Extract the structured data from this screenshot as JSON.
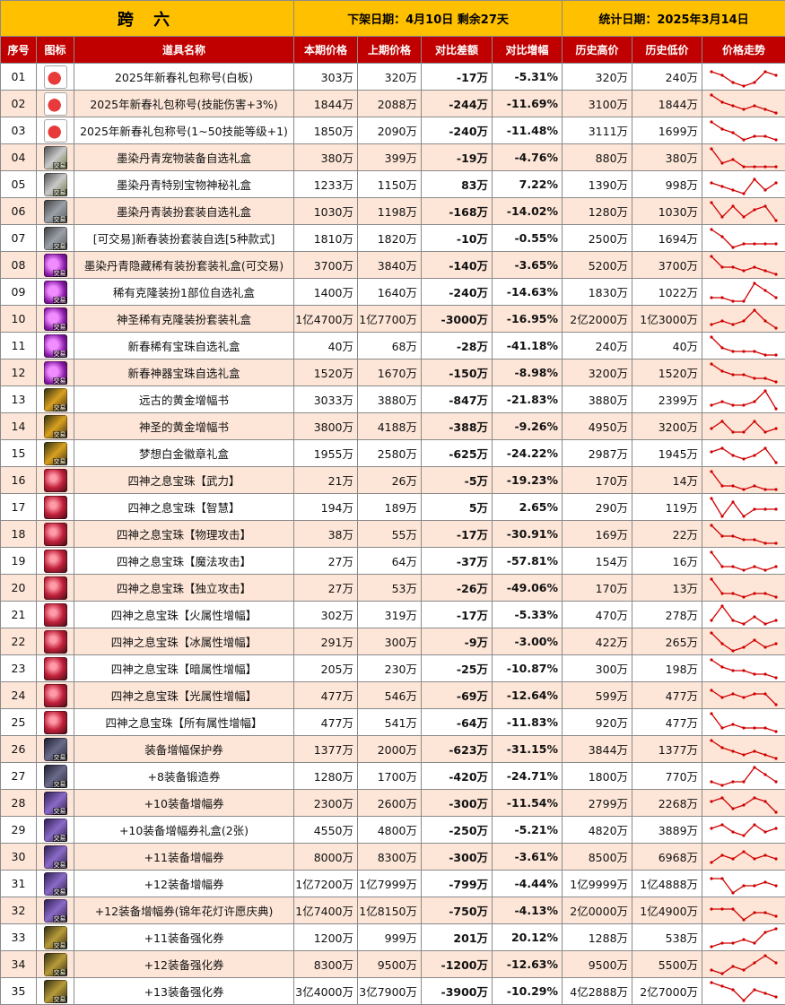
{
  "header": {
    "region": "跨 六",
    "removal": "下架日期：4月10日  剩余27天",
    "stat_date": "统计日期：2025年3月14日"
  },
  "columns": [
    "序号",
    "图标",
    "道具名称",
    "本期价格",
    "上期价格",
    "对比差额",
    "对比增幅",
    "历史高价",
    "历史低价",
    "价格走势"
  ],
  "colors": {
    "header_bg": "#ffc000",
    "column_bg": "#c00000",
    "alt_row": "#fde6d8",
    "up": "#e00000",
    "down": "#1aa34a"
  },
  "rows": [
    {
      "no": "01",
      "icon": "gift-icon",
      "tag": "",
      "name": "2025年新春礼包称号(白板)",
      "cur": "303万",
      "prev": "320万",
      "diff": "-17万",
      "pct": "-5.31%",
      "high": "320万",
      "low": "240万",
      "trend": [
        5,
        4,
        2,
        1,
        2,
        5,
        4
      ]
    },
    {
      "no": "02",
      "icon": "gift-icon",
      "tag": "",
      "name": "2025年新春礼包称号(技能伤害+3%)",
      "cur": "1844万",
      "prev": "2088万",
      "diff": "-244万",
      "pct": "-11.69%",
      "high": "3100万",
      "low": "1844万",
      "trend": [
        6,
        4,
        3,
        2,
        3,
        2,
        1
      ]
    },
    {
      "no": "03",
      "icon": "gift-icon",
      "tag": "",
      "name": "2025年新春礼包称号(1~50技能等级+1)",
      "cur": "1850万",
      "prev": "2090万",
      "diff": "-240万",
      "pct": "-11.48%",
      "high": "3111万",
      "low": "1699万",
      "trend": [
        6,
        4,
        3,
        1,
        2,
        2,
        1
      ]
    },
    {
      "no": "04",
      "icon": "dye-icon",
      "tag": "交易",
      "name": "墨染丹青宠物装备自选礼盒",
      "cur": "380万",
      "prev": "399万",
      "diff": "-19万",
      "pct": "-4.76%",
      "high": "880万",
      "low": "380万",
      "trend": [
        6,
        2,
        3,
        1,
        1,
        1,
        1
      ]
    },
    {
      "no": "05",
      "icon": "dye-icon",
      "tag": "交易",
      "name": "墨染丹青特别宝物神秘礼盒",
      "cur": "1233万",
      "prev": "1150万",
      "diff": "83万",
      "pct": "7.22%",
      "high": "1390万",
      "low": "998万",
      "trend": [
        4,
        3,
        2,
        1,
        5,
        2,
        4
      ]
    },
    {
      "no": "06",
      "icon": "dye2-icon",
      "tag": "交易",
      "name": "墨染丹青装扮套装自选礼盒",
      "cur": "1030万",
      "prev": "1198万",
      "diff": "-168万",
      "pct": "-14.02%",
      "high": "1280万",
      "low": "1030万",
      "trend": [
        6,
        2,
        5,
        2,
        4,
        5,
        1
      ]
    },
    {
      "no": "07",
      "icon": "dye2-icon",
      "tag": "交易",
      "name": "[可交易]新春装扮套装自选[5种款式]",
      "cur": "1810万",
      "prev": "1820万",
      "diff": "-10万",
      "pct": "-0.55%",
      "high": "2500万",
      "low": "1694万",
      "trend": [
        6,
        4,
        1,
        2,
        2,
        2,
        2
      ]
    },
    {
      "no": "08",
      "icon": "purple-icon",
      "tag": "交易",
      "name": "墨染丹青隐藏稀有装扮套装礼盒(可交易)",
      "cur": "3700万",
      "prev": "3840万",
      "diff": "-140万",
      "pct": "-3.65%",
      "high": "5200万",
      "low": "3700万",
      "trend": [
        6,
        3,
        3,
        2,
        3,
        2,
        1
      ]
    },
    {
      "no": "09",
      "icon": "purple-icon",
      "tag": "交易",
      "name": "稀有克隆装扮1部位自选礼盒",
      "cur": "1400万",
      "prev": "1640万",
      "diff": "-240万",
      "pct": "-14.63%",
      "high": "1830万",
      "low": "1022万",
      "trend": [
        2,
        2,
        1,
        1,
        6,
        4,
        2
      ]
    },
    {
      "no": "10",
      "icon": "purple-icon",
      "tag": "交易",
      "name": "神圣稀有克隆装扮套装礼盒",
      "cur": "1亿4700万",
      "prev": "1亿7700万",
      "diff": "-3000万",
      "pct": "-16.95%",
      "high": "2亿2000万",
      "low": "1亿3000万",
      "trend": [
        2,
        3,
        2,
        3,
        6,
        3,
        1
      ]
    },
    {
      "no": "11",
      "icon": "purple-icon",
      "tag": "交易",
      "name": "新春稀有宝珠自选礼盒",
      "cur": "40万",
      "prev": "68万",
      "diff": "-28万",
      "pct": "-41.18%",
      "high": "240万",
      "low": "40万",
      "trend": [
        6,
        3,
        2,
        2,
        2,
        1,
        1
      ]
    },
    {
      "no": "12",
      "icon": "purple-icon",
      "tag": "交易",
      "name": "新春神器宝珠自选礼盒",
      "cur": "1520万",
      "prev": "1670万",
      "diff": "-150万",
      "pct": "-8.98%",
      "high": "3200万",
      "low": "1520万",
      "trend": [
        6,
        4,
        3,
        3,
        2,
        2,
        1
      ]
    },
    {
      "no": "13",
      "icon": "gold-icon",
      "tag": "交易",
      "name": "远古的黄金增幅书",
      "cur": "3033万",
      "prev": "3880万",
      "diff": "-847万",
      "pct": "-21.83%",
      "high": "3880万",
      "low": "2399万",
      "trend": [
        2,
        3,
        2,
        2,
        3,
        6,
        1
      ]
    },
    {
      "no": "14",
      "icon": "gold-icon",
      "tag": "交易",
      "name": "神圣的黄金增幅书",
      "cur": "3800万",
      "prev": "4188万",
      "diff": "-388万",
      "pct": "-9.26%",
      "high": "4950万",
      "low": "3200万",
      "trend": [
        3,
        5,
        2,
        2,
        5,
        2,
        3
      ]
    },
    {
      "no": "15",
      "icon": "gold-icon",
      "tag": "交易",
      "name": "梦想白金徽章礼盒",
      "cur": "1955万",
      "prev": "2580万",
      "diff": "-625万",
      "pct": "-24.22%",
      "high": "2987万",
      "low": "1945万",
      "trend": [
        4,
        5,
        3,
        2,
        3,
        5,
        1
      ]
    },
    {
      "no": "16",
      "icon": "gem-icon",
      "tag": "",
      "name": "四神之息宝珠【武力】",
      "cur": "21万",
      "prev": "26万",
      "diff": "-5万",
      "pct": "-19.23%",
      "high": "170万",
      "low": "14万",
      "trend": [
        6,
        2,
        2,
        1,
        2,
        1,
        1
      ]
    },
    {
      "no": "17",
      "icon": "gem-icon",
      "tag": "",
      "name": "四神之息宝珠【智慧】",
      "cur": "194万",
      "prev": "189万",
      "diff": "5万",
      "pct": "2.65%",
      "high": "290万",
      "low": "119万",
      "trend": [
        6,
        1,
        5,
        1,
        3,
        3,
        3
      ]
    },
    {
      "no": "18",
      "icon": "gem-icon",
      "tag": "",
      "name": "四神之息宝珠【物理攻击】",
      "cur": "38万",
      "prev": "55万",
      "diff": "-17万",
      "pct": "-30.91%",
      "high": "169万",
      "low": "22万",
      "trend": [
        6,
        3,
        3,
        2,
        2,
        1,
        1
      ]
    },
    {
      "no": "19",
      "icon": "gem-icon",
      "tag": "",
      "name": "四神之息宝珠【魔法攻击】",
      "cur": "27万",
      "prev": "64万",
      "diff": "-37万",
      "pct": "-57.81%",
      "high": "154万",
      "low": "16万",
      "trend": [
        6,
        2,
        2,
        1,
        2,
        1,
        2
      ]
    },
    {
      "no": "20",
      "icon": "gem-icon",
      "tag": "",
      "name": "四神之息宝珠【独立攻击】",
      "cur": "27万",
      "prev": "53万",
      "diff": "-26万",
      "pct": "-49.06%",
      "high": "170万",
      "low": "13万",
      "trend": [
        6,
        2,
        2,
        1,
        2,
        2,
        1
      ]
    },
    {
      "no": "21",
      "icon": "gem-icon",
      "tag": "",
      "name": "四神之息宝珠【火属性增幅】",
      "cur": "302万",
      "prev": "319万",
      "diff": "-17万",
      "pct": "-5.33%",
      "high": "470万",
      "low": "278万",
      "trend": [
        2,
        6,
        2,
        1,
        3,
        1,
        2
      ]
    },
    {
      "no": "22",
      "icon": "gem-icon",
      "tag": "",
      "name": "四神之息宝珠【冰属性增幅】",
      "cur": "291万",
      "prev": "300万",
      "diff": "-9万",
      "pct": "-3.00%",
      "high": "422万",
      "low": "265万",
      "trend": [
        6,
        3,
        1,
        2,
        4,
        2,
        3
      ]
    },
    {
      "no": "23",
      "icon": "gem-icon",
      "tag": "",
      "name": "四神之息宝珠【暗属性增幅】",
      "cur": "205万",
      "prev": "230万",
      "diff": "-25万",
      "pct": "-10.87%",
      "high": "300万",
      "low": "198万",
      "trend": [
        6,
        4,
        3,
        3,
        2,
        2,
        1
      ]
    },
    {
      "no": "24",
      "icon": "gem-icon",
      "tag": "",
      "name": "四神之息宝珠【光属性增幅】",
      "cur": "477万",
      "prev": "546万",
      "diff": "-69万",
      "pct": "-12.64%",
      "high": "599万",
      "low": "477万",
      "trend": [
        5,
        3,
        4,
        3,
        4,
        4,
        1
      ]
    },
    {
      "no": "25",
      "icon": "gem-icon",
      "tag": "",
      "name": "四神之息宝珠【所有属性增幅】",
      "cur": "477万",
      "prev": "541万",
      "diff": "-64万",
      "pct": "-11.83%",
      "high": "920万",
      "low": "477万",
      "trend": [
        6,
        2,
        3,
        2,
        2,
        2,
        1
      ]
    },
    {
      "no": "26",
      "icon": "ticket-icon",
      "tag": "交易",
      "name": "装备增幅保护券",
      "cur": "1377万",
      "prev": "2000万",
      "diff": "-623万",
      "pct": "-31.15%",
      "high": "3844万",
      "low": "1377万",
      "trend": [
        6,
        4,
        3,
        2,
        3,
        2,
        1
      ]
    },
    {
      "no": "27",
      "icon": "ticket-icon",
      "tag": "交易",
      "name": "+8装备锻造券",
      "cur": "1280万",
      "prev": "1700万",
      "diff": "-420万",
      "pct": "-24.71%",
      "high": "1800万",
      "low": "770万",
      "trend": [
        2,
        1,
        2,
        2,
        6,
        4,
        2
      ]
    },
    {
      "no": "28",
      "icon": "ticket2-icon",
      "tag": "交易",
      "name": "+10装备增幅券",
      "cur": "2300万",
      "prev": "2600万",
      "diff": "-300万",
      "pct": "-11.54%",
      "high": "2799万",
      "low": "2268万",
      "trend": [
        4,
        5,
        2,
        3,
        5,
        4,
        1
      ]
    },
    {
      "no": "29",
      "icon": "ticket2-icon",
      "tag": "交易",
      "name": "+10装备增幅券礼盒(2张)",
      "cur": "4550万",
      "prev": "4800万",
      "diff": "-250万",
      "pct": "-5.21%",
      "high": "4820万",
      "low": "3889万",
      "trend": [
        4,
        5,
        3,
        2,
        5,
        3,
        4
      ]
    },
    {
      "no": "30",
      "icon": "ticket2-icon",
      "tag": "交易",
      "name": "+11装备增幅券",
      "cur": "8000万",
      "prev": "8300万",
      "diff": "-300万",
      "pct": "-3.61%",
      "high": "8500万",
      "low": "6968万",
      "trend": [
        2,
        4,
        3,
        5,
        3,
        4,
        3
      ]
    },
    {
      "no": "31",
      "icon": "ticket2-icon",
      "tag": "交易",
      "name": "+12装备增幅券",
      "cur": "1亿7200万",
      "prev": "1亿7999万",
      "diff": "-799万",
      "pct": "-4.44%",
      "high": "1亿9999万",
      "low": "1亿4888万",
      "trend": [
        5,
        5,
        1,
        3,
        3,
        4,
        3
      ]
    },
    {
      "no": "32",
      "icon": "ticket2-icon",
      "tag": "交易",
      "name": "+12装备增幅券(锦年花灯许愿庆典)",
      "cur": "1亿7400万",
      "prev": "1亿8150万",
      "diff": "-750万",
      "pct": "-4.13%",
      "high": "2亿0000万",
      "low": "1亿4900万",
      "trend": [
        4,
        4,
        4,
        1,
        3,
        3,
        2
      ]
    },
    {
      "no": "33",
      "icon": "ticket3-icon",
      "tag": "交易",
      "name": "+11装备强化券",
      "cur": "1200万",
      "prev": "999万",
      "diff": "201万",
      "pct": "20.12%",
      "high": "1288万",
      "low": "538万",
      "trend": [
        1,
        2,
        2,
        3,
        2,
        5,
        6
      ]
    },
    {
      "no": "34",
      "icon": "ticket3-icon",
      "tag": "交易",
      "name": "+12装备强化券",
      "cur": "8300万",
      "prev": "9500万",
      "diff": "-1200万",
      "pct": "-12.63%",
      "high": "9500万",
      "low": "5500万",
      "trend": [
        2,
        1,
        3,
        2,
        4,
        6,
        4
      ]
    },
    {
      "no": "35",
      "icon": "ticket3-icon",
      "tag": "交易",
      "name": "+13装备强化券",
      "cur": "3亿4000万",
      "prev": "3亿7900万",
      "diff": "-3900万",
      "pct": "-10.29%",
      "high": "4亿2888万",
      "low": "2亿7000万",
      "trend": [
        6,
        5,
        4,
        1,
        4,
        3,
        2
      ]
    }
  ]
}
